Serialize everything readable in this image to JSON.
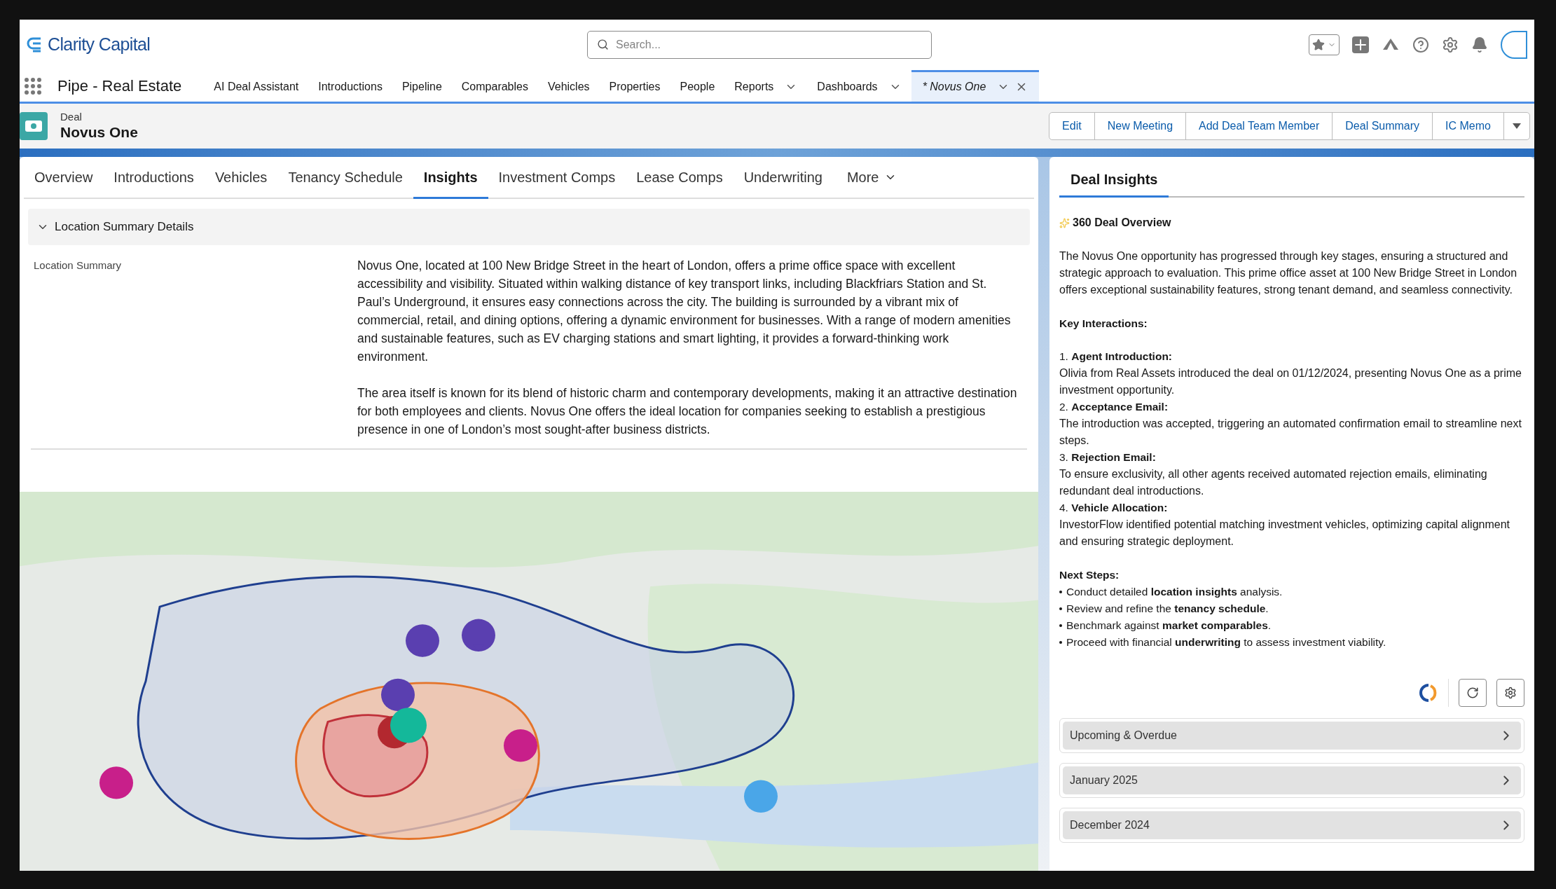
{
  "header": {
    "logo_text": "Clarity Capital",
    "search": {
      "placeholder": "Search..."
    }
  },
  "nav": {
    "app_name": "Pipe - Real Estate",
    "items": [
      {
        "label": "AI Deal Assistant",
        "has_menu": false,
        "selected": false,
        "closable": false
      },
      {
        "label": "Introductions",
        "has_menu": false,
        "selected": false,
        "closable": false
      },
      {
        "label": "Pipeline",
        "has_menu": false,
        "selected": false,
        "closable": false
      },
      {
        "label": "Comparables",
        "has_menu": false,
        "selected": false,
        "closable": false
      },
      {
        "label": "Vehicles",
        "has_menu": false,
        "selected": false,
        "closable": false
      },
      {
        "label": "Properties",
        "has_menu": false,
        "selected": false,
        "closable": false
      },
      {
        "label": "People",
        "has_menu": false,
        "selected": false,
        "closable": false
      },
      {
        "label": "Reports",
        "has_menu": true,
        "selected": false,
        "closable": false
      },
      {
        "label": "Dashboards",
        "has_menu": true,
        "selected": false,
        "closable": false
      },
      {
        "label": "* Novus One",
        "has_menu": true,
        "selected": true,
        "closable": true
      }
    ]
  },
  "record": {
    "type": "Deal",
    "name": "Novus One",
    "actions": [
      "Edit",
      "New Meeting",
      "Add Deal Team Member",
      "Deal Summary",
      "IC Memo"
    ]
  },
  "tabs": [
    {
      "label": "Overview",
      "selected": false
    },
    {
      "label": "Introductions",
      "selected": false
    },
    {
      "label": "Vehicles",
      "selected": false
    },
    {
      "label": "Tenancy Schedule",
      "selected": false
    },
    {
      "label": "Insights",
      "selected": true
    },
    {
      "label": "Investment Comps",
      "selected": false
    },
    {
      "label": "Lease Comps",
      "selected": false
    },
    {
      "label": "Underwriting",
      "selected": false
    }
  ],
  "more_tab": "More",
  "section": {
    "title": "Location Summary Details",
    "expanded": true,
    "field_label": "Location Summary",
    "paragraphs": [
      "Novus One, located at 100 New Bridge Street in the heart of London, offers a prime office space with excellent accessibility and visibility. Situated within walking distance of key transport links, including Blackfriars Station and St. Paul’s Underground, it ensures easy connections across the city. The building is surrounded by a vibrant mix of commercial, retail, and dining options, offering a dynamic environment for businesses. With a range of modern amenities and sustainable features, such as EV charging stations and smart lighting, it provides a forward-thinking work environment.",
      "The area itself is known for its blend of historic charm and contemporary developments, making it an attractive destination for both employees and clients. Novus One offers the ideal location for companies seeking to establish a prestigious presence in one of London’s most sought-after business districts."
    ]
  },
  "insights": {
    "tab": "Deal Insights",
    "heading": "360 Deal Overview",
    "overview": "The Novus One opportunity has progressed through key stages, ensuring a structured and strategic approach to evaluation. This prime office asset at 100 New Bridge Street in London offers exceptional sustainability features, strong tenant demand, and seamless connectivity.",
    "key_title": "Key Interactions:",
    "interactions": [
      {
        "title": "1. **Agent Introduction:**",
        "text": "Olivia from Real Assets introduced the deal on 01/12/2024, presenting Novus One as a prime investment opportunity."
      },
      {
        "title": "2. **Acceptance Email:**",
        "text": "The introduction was accepted, triggering an automated confirmation email to streamline next steps."
      },
      {
        "title": "3. **Rejection Email:**",
        "text": "To ensure exclusivity, all other agents received automated rejection emails, eliminating redundant deal introductions."
      },
      {
        "title": "4. **Vehicle Allocation:**",
        "text": "InvestorFlow identified potential matching investment vehicles, optimizing capital alignment and ensuring strategic deployment."
      }
    ],
    "next_title": "Next Steps:",
    "next_steps": [
      "Conduct detailed **location insights** analysis.",
      "Review and refine the **tenancy schedule**.",
      "Benchmark against **market comparables**.",
      "Proceed with financial **underwriting** to assess investment viability."
    ],
    "accordions": [
      {
        "label": "Upcoming & Overdue",
        "expanded": false
      },
      {
        "label": "January 2025",
        "expanded": false
      },
      {
        "label": "December 2024",
        "expanded": false
      }
    ]
  }
}
